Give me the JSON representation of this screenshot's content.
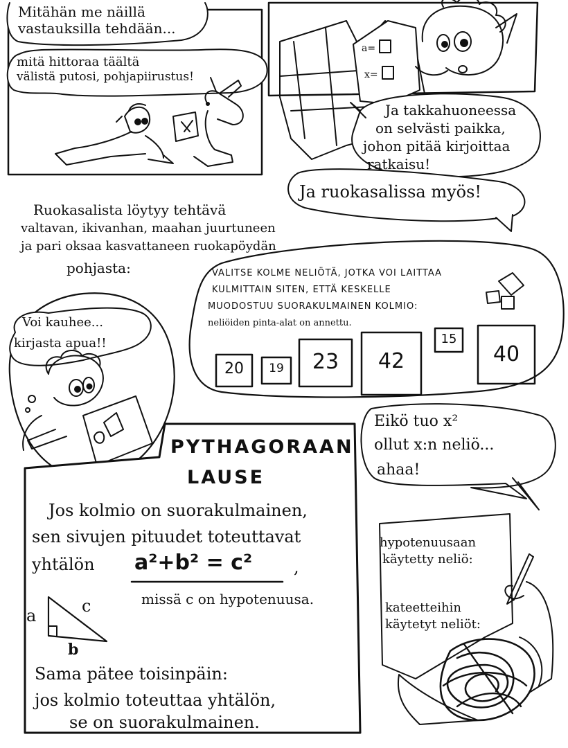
{
  "panel1": {
    "thought1_line1": "Mitähän me näillä",
    "thought1_line2": "vastauksilla tehdään...",
    "thought2_line1": "mitä hittoraa täältä",
    "thought2_line2": "välistä putosi, pohjapiirustus!"
  },
  "panel2": {
    "map_label_a": "a=",
    "map_label_x": "x=",
    "bubble1_line1": "Ja takkahuoneessa",
    "bubble1_line2": "on selvästi paikka,",
    "bubble1_line3": "johon pitää kirjoittaa",
    "bubble1_line4": "ratkaisu!",
    "bubble2": "Ja ruokasalissa myös!"
  },
  "narration": {
    "line1": "Ruokasalista löytyy tehtävä",
    "line2": "valtavan, ikivanhan, maahan juurtuneen",
    "line3": "ja pari oksaa kasvattaneen ruokapöydän",
    "line4": "pohjasta:"
  },
  "task": {
    "line1": "VALITSE KOLME NELIÖTÄ, JOTKA VOI LAITTAA",
    "line2": "KULMITTAIN SITEN, ETTÄ KESKELLE",
    "line3": "MUODOSTUU SUORAKULMAINEN KOLMIO:",
    "line4": "neliöiden pinta-alat on annettu.",
    "squares": [
      "20",
      "19",
      "23",
      "42",
      "15",
      "40"
    ]
  },
  "reader": {
    "thought_line1": "Voi kauhee...",
    "thought_line2": "kirjasta apua!!"
  },
  "theorem": {
    "title_line1": "PYTHAGORAAN",
    "title_line2": "LAUSE",
    "text_line1": "Jos kolmio on suorakulmainen,",
    "text_line2": "sen sivujen pituudet toteuttavat",
    "text_line3": "yhtälön",
    "equation": "a²+b² = c²",
    "comma": ",",
    "note": "missä c on hypotenuusa.",
    "label_a": "a",
    "label_b": "b",
    "label_c": "c",
    "converse_line1": "Sama pätee toisinpäin:",
    "converse_line2": "jos kolmio toteuttaa yhtälön,",
    "converse_line3": "se on suorakulmainen."
  },
  "realization": {
    "line1": "Eikö tuo x²",
    "line2": "ollut x:n neliö...",
    "line3": "ahaa!"
  },
  "notes": {
    "line1": "hypotenuusaan",
    "line2": "käytetty neliö:",
    "line3": "kateetteihin",
    "line4": "käytetyt neliöt:"
  }
}
